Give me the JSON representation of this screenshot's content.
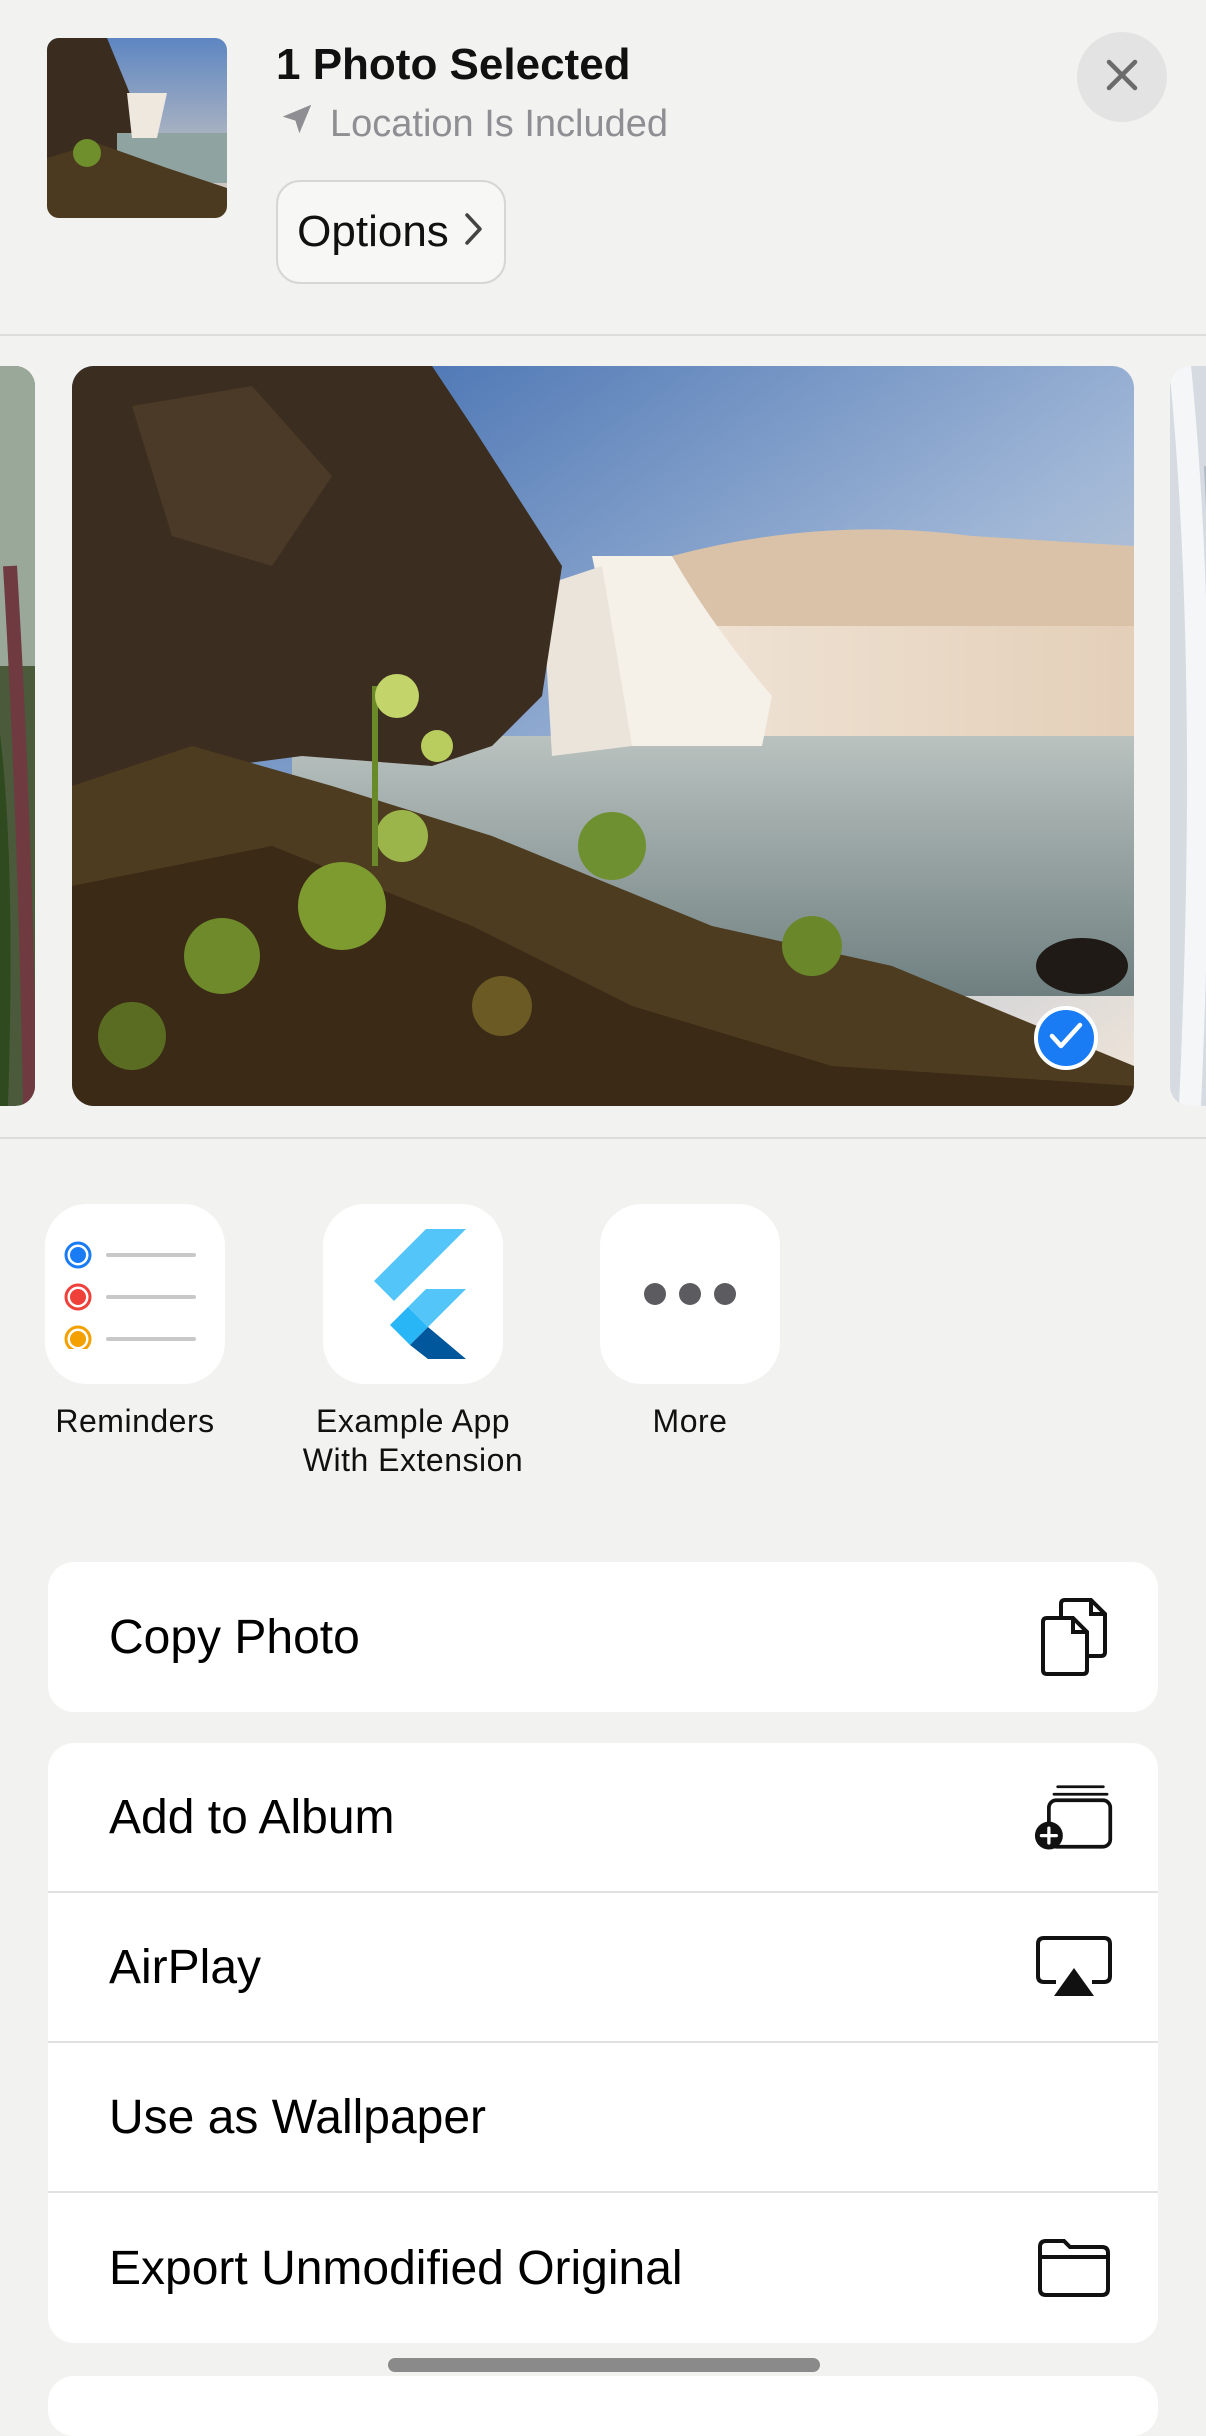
{
  "header": {
    "title": "1 Photo Selected",
    "subtitle": "Location Is Included",
    "options_label": "Options"
  },
  "apps": [
    {
      "label": "Reminders",
      "icon": "reminders-icon"
    },
    {
      "label": "Example App With Extension",
      "icon": "flutter-icon"
    },
    {
      "label": "More",
      "icon": "more-icon"
    }
  ],
  "actions_group1": [
    {
      "label": "Copy Photo",
      "icon": "copy-icon"
    }
  ],
  "actions_group2": [
    {
      "label": "Add to Album",
      "icon": "add-to-album-icon"
    },
    {
      "label": "AirPlay",
      "icon": "airplay-icon"
    },
    {
      "label": "Use as Wallpaper",
      "icon": ""
    },
    {
      "label": "Export Unmodified Original",
      "icon": "folder-icon"
    }
  ],
  "colors": {
    "accent": "#1a7cf5",
    "background": "#f2f2f1",
    "secondary_text": "#8e8e93"
  }
}
